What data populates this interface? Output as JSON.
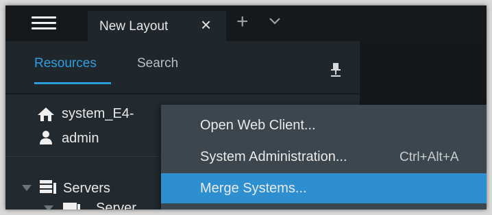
{
  "topbar": {
    "tab_label": "New Layout",
    "tab_close": "×",
    "add_tab": "+"
  },
  "panel": {
    "tabs": [
      "Resources",
      "Search"
    ],
    "active_tab": "Resources"
  },
  "tree": {
    "system": "system_E4-",
    "user": "admin",
    "servers": "Servers",
    "server_child": "Server"
  },
  "context_menu": {
    "items": [
      {
        "label": "Open Web Client...",
        "shortcut": ""
      },
      {
        "label": "System Administration...",
        "shortcut": "Ctrl+Alt+A"
      },
      {
        "label": "Merge Systems...",
        "shortcut": ""
      }
    ],
    "selected": "Merge Systems..."
  },
  "colors": {
    "accent": "#2f9ee1",
    "highlight": "#2d8fd0",
    "menu_bg": "#3b464e"
  }
}
